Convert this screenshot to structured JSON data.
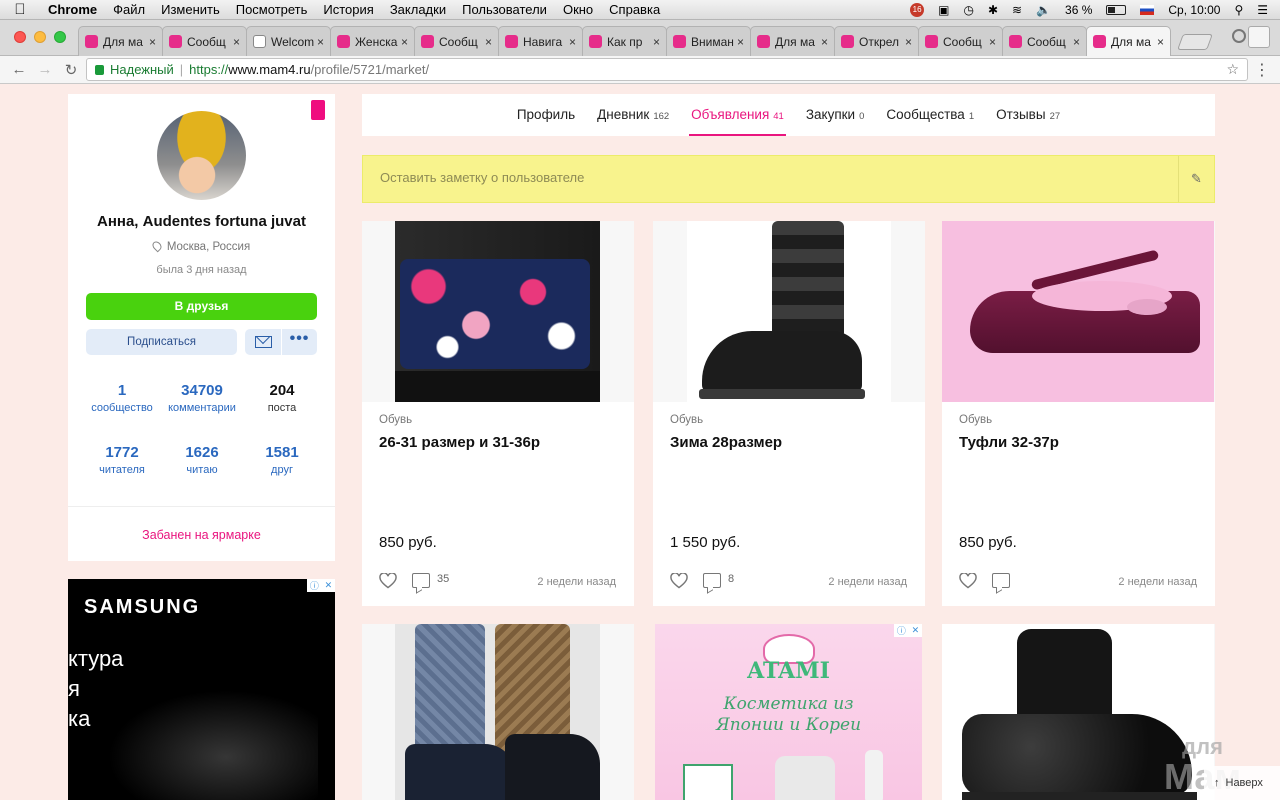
{
  "menubar": {
    "app": "Chrome",
    "items": [
      "Файл",
      "Изменить",
      "Посмотреть",
      "История",
      "Закладки",
      "Пользователи",
      "Окно",
      "Справка"
    ],
    "notif_count": "16",
    "battery": "36 %",
    "clock": "Ср, 10:00"
  },
  "tabs": [
    {
      "title": "Для ма",
      "icon": "mam-icon"
    },
    {
      "title": "Сообщ",
      "icon": "mam-icon"
    },
    {
      "title": "Welcom",
      "icon": "doc-icon"
    },
    {
      "title": "Женска",
      "icon": "mam-icon"
    },
    {
      "title": "Сообщ",
      "icon": "mam-icon"
    },
    {
      "title": "Навига",
      "icon": "mam-icon"
    },
    {
      "title": "Как пр",
      "icon": "mam-icon"
    },
    {
      "title": "Вниман",
      "icon": "mam-icon"
    },
    {
      "title": "Для ма",
      "icon": "mam-icon"
    },
    {
      "title": "Открел",
      "icon": "mam-icon"
    },
    {
      "title": "Сообщ",
      "icon": "mam-icon"
    },
    {
      "title": "Сообщ",
      "icon": "mam-icon"
    },
    {
      "title": "Для ма",
      "icon": "mam-icon",
      "active": true
    }
  ],
  "address": {
    "secure_label": "Надежный",
    "scheme": "https://",
    "host": "www.mam4.ru",
    "path": "/profile/5721/market/"
  },
  "profile": {
    "name": "Анна, Audentes fortuna juvat",
    "location": "Москва, Россия",
    "last_seen": "была 3 дня назад",
    "friend_btn": "В друзья",
    "subscribe_btn": "Подписаться",
    "more_btn": "•••",
    "stats": [
      {
        "num": "1",
        "label": "сообщество"
      },
      {
        "num": "34709",
        "label": "комментарии"
      },
      {
        "num": "204",
        "label": "поста"
      },
      {
        "num": "1772",
        "label": "читателя"
      },
      {
        "num": "1626",
        "label": "читаю"
      },
      {
        "num": "1581",
        "label": "друг"
      }
    ],
    "banned": "Забанен на ярмарке"
  },
  "ad_samsung": {
    "brand": "SAMSUNG",
    "line1": "ктура",
    "line2": "я",
    "line3": "ка"
  },
  "nav": [
    {
      "label": "Профиль",
      "count": ""
    },
    {
      "label": "Дневник",
      "count": "162"
    },
    {
      "label": "Объявления",
      "count": "41",
      "active": true
    },
    {
      "label": "Закупки",
      "count": "0"
    },
    {
      "label": "Сообщества",
      "count": "1"
    },
    {
      "label": "Отзывы",
      "count": "27"
    }
  ],
  "note": {
    "placeholder": "Оставить заметку о пользователе"
  },
  "items": [
    {
      "category": "Обувь",
      "title": "26-31 размер и 31-36р",
      "price": "850 руб.",
      "comments": "35",
      "date": "2 недели назад"
    },
    {
      "category": "Обувь",
      "title": "Зима 28размер",
      "price": "1 550 руб.",
      "comments": "8",
      "date": "2 недели назад"
    },
    {
      "category": "Обувь",
      "title": "Туфли 32-37р",
      "price": "850 руб.",
      "comments": "",
      "date": "2 недели назад"
    }
  ],
  "ad_atami": {
    "brand": "ATAMI",
    "tagline1": "Косметика из",
    "tagline2": "Японии и Кореи"
  },
  "watermark": {
    "top": "для",
    "bottom": "Мам"
  },
  "back_to_top": "Наверх"
}
